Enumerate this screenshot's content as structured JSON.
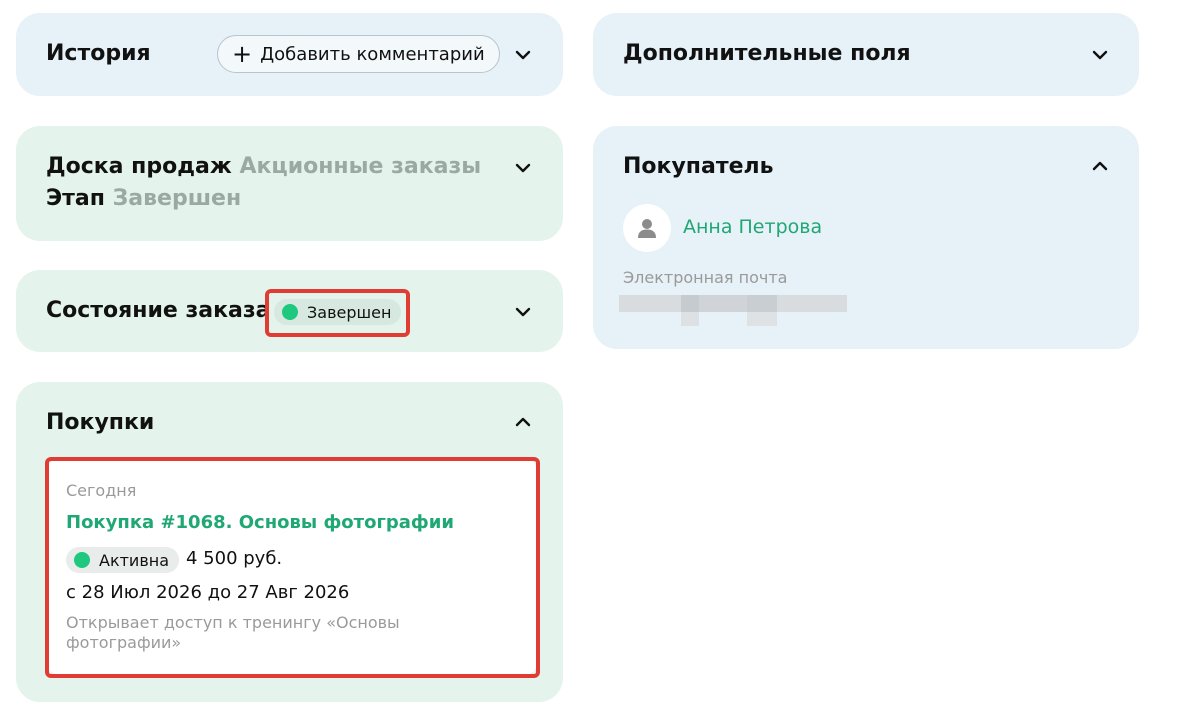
{
  "history": {
    "title": "История",
    "add_comment_label": "Добавить комментарий"
  },
  "extra_fields": {
    "title": "Дополнительные поля"
  },
  "sales_board": {
    "board_label": "Доска продаж",
    "board_value": "Акционные заказы",
    "stage_label": "Этап",
    "stage_value": "Завершен"
  },
  "buyer": {
    "title": "Покупатель",
    "name": "Анна Петрова",
    "email_label": "Электронная почта"
  },
  "order_state": {
    "title": "Состояние заказа",
    "status": "Завершен"
  },
  "purchases": {
    "title": "Покупки",
    "items": [
      {
        "date": "Сегодня",
        "name": "Покупка #1068. Основы фотографии",
        "status": "Активна",
        "price": "4 500 руб.",
        "period": "с 28 Июл 2026 до 27 Авг 2026",
        "description_line1": "Открывает доступ к тренингу «Основы",
        "description_line2": "фотографии»"
      }
    ]
  },
  "colors": {
    "accent_green": "#1fa774",
    "status_dot": "#1fc87f",
    "highlight_red": "#e03c34",
    "card_blue": "#e6f1f8",
    "card_green": "#e4f3ec"
  },
  "icons": {
    "chevron_down": "chevron-down-icon",
    "chevron_up": "chevron-up-icon",
    "plus": "plus-icon",
    "user": "user-icon"
  }
}
